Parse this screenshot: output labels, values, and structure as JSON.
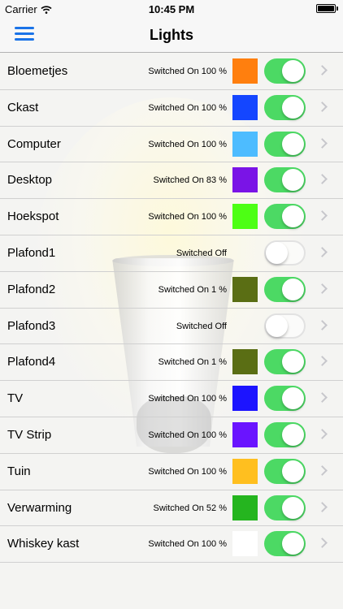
{
  "status_bar": {
    "carrier": "Carrier",
    "time": "10:45 PM",
    "battery_level": 1.0
  },
  "nav": {
    "title": "Lights",
    "menu_icon": "hamburger-menu-icon"
  },
  "lights": [
    {
      "name": "Bloemetjes",
      "status": "Switched On 100 %",
      "color": "#ff7f0e",
      "on": true
    },
    {
      "name": "Ckast",
      "status": "Switched On 100 %",
      "color": "#1446ff",
      "on": true
    },
    {
      "name": "Computer",
      "status": "Switched On 100 %",
      "color": "#4dbcff",
      "on": true
    },
    {
      "name": "Desktop",
      "status": "Switched On 83 %",
      "color": "#7a14e6",
      "on": true
    },
    {
      "name": "Hoekspot",
      "status": "Switched On 100 %",
      "color": "#4dff14",
      "on": true
    },
    {
      "name": "Plafond1",
      "status": "Switched Off",
      "color": null,
      "on": false
    },
    {
      "name": "Plafond2",
      "status": "Switched On 1 %",
      "color": "#5a6e14",
      "on": true
    },
    {
      "name": "Plafond3",
      "status": "Switched Off",
      "color": null,
      "on": false
    },
    {
      "name": "Plafond4",
      "status": "Switched On 1 %",
      "color": "#5a6e14",
      "on": true
    },
    {
      "name": "TV",
      "status": "Switched On 100 %",
      "color": "#1c14ff",
      "on": true
    },
    {
      "name": "TV Strip",
      "status": "Switched On 100 %",
      "color": "#6a14ff",
      "on": true
    },
    {
      "name": "Tuin",
      "status": "Switched On 100 %",
      "color": "#ffbf1f",
      "on": true
    },
    {
      "name": "Verwarming",
      "status": "Switched On 52 %",
      "color": "#25b51f",
      "on": true
    },
    {
      "name": "Whiskey kast",
      "status": "Switched On 100 %",
      "color": "#ffffff",
      "on": true
    }
  ]
}
